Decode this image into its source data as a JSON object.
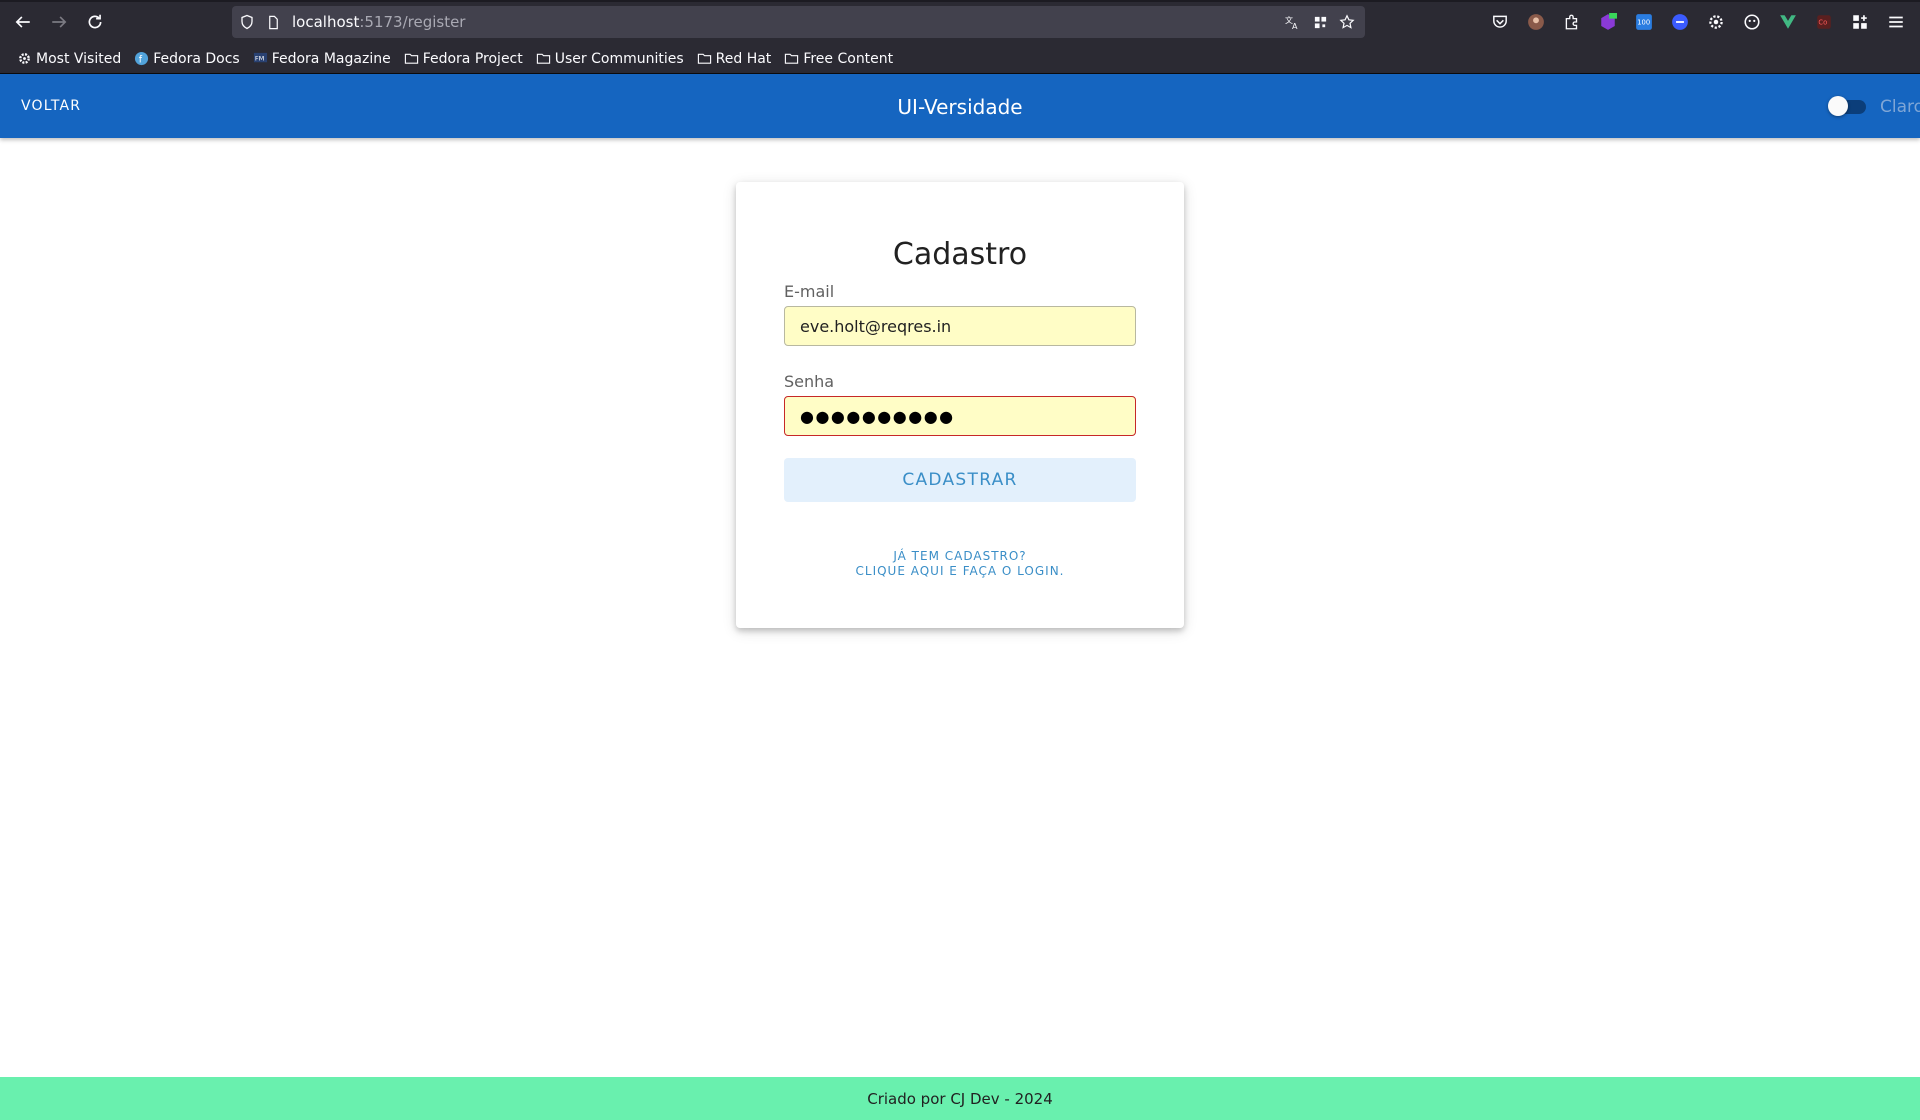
{
  "browser": {
    "url_host": "localhost",
    "url_path": ":5173/register",
    "bookmarks": [
      {
        "label": "Most Visited",
        "icon": "gear-icon"
      },
      {
        "label": "Fedora Docs",
        "icon": "fedora-icon"
      },
      {
        "label": "Fedora Magazine",
        "icon": "fm-icon"
      },
      {
        "label": "Fedora Project",
        "icon": "folder-icon"
      },
      {
        "label": "User Communities",
        "icon": "folder-icon"
      },
      {
        "label": "Red Hat",
        "icon": "folder-icon"
      },
      {
        "label": "Free Content",
        "icon": "folder-icon"
      }
    ]
  },
  "appbar": {
    "back_label": "VOLTAR",
    "title": "UI-Versidade",
    "theme_label": "Claro",
    "color": "#1565c0"
  },
  "form": {
    "title": "Cadastro",
    "email_label": "E-mail",
    "email_value": "eve.holt@reqres.in",
    "password_label": "Senha",
    "password_value": "●●●●●●●●●●",
    "submit_label": "CADASTRAR",
    "login_line1": "JÁ TEM CADASTRO?",
    "login_line2": "CLIQUE AQUI E FAÇA O LOGIN."
  },
  "footer": {
    "text": "Criado por CJ Dev - 2024",
    "color": "#69f0ae"
  }
}
